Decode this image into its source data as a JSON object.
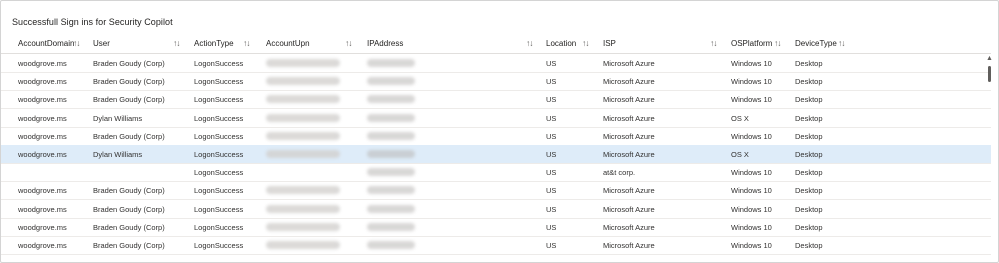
{
  "title": "Successfull Sign ins for Security Copilot",
  "columns": [
    {
      "label": "AccountDomain"
    },
    {
      "label": "User"
    },
    {
      "label": "ActionType"
    },
    {
      "label": "AccountUpn"
    },
    {
      "label": "IPAddress"
    },
    {
      "label": "Location"
    },
    {
      "label": "ISP"
    },
    {
      "label": "OSPlatform"
    },
    {
      "label": "DeviceType"
    }
  ],
  "sort_glyph": "↑↓",
  "rows": [
    {
      "domain": "woodgrove.ms",
      "user": "Braden Goudy (Corp)",
      "action": "LogonSuccess",
      "upn": "",
      "ip": "",
      "location": "US",
      "isp": "Microsoft Azure",
      "os": "Windows 10",
      "device": "Desktop"
    },
    {
      "domain": "woodgrove.ms",
      "user": "Braden Goudy (Corp)",
      "action": "LogonSuccess",
      "upn": "",
      "ip": "",
      "location": "US",
      "isp": "Microsoft Azure",
      "os": "Windows 10",
      "device": "Desktop"
    },
    {
      "domain": "woodgrove.ms",
      "user": "Braden Goudy (Corp)",
      "action": "LogonSuccess",
      "upn": "",
      "ip": "",
      "location": "US",
      "isp": "Microsoft Azure",
      "os": "Windows 10",
      "device": "Desktop"
    },
    {
      "domain": "woodgrove.ms",
      "user": "Dylan Williams",
      "action": "LogonSuccess",
      "upn": "",
      "ip": "",
      "location": "US",
      "isp": "Microsoft Azure",
      "os": "OS X",
      "device": "Desktop"
    },
    {
      "domain": "woodgrove.ms",
      "user": "Braden Goudy (Corp)",
      "action": "LogonSuccess",
      "upn": "",
      "ip": "",
      "location": "US",
      "isp": "Microsoft Azure",
      "os": "Windows 10",
      "device": "Desktop"
    },
    {
      "domain": "woodgrove.ms",
      "user": "Dylan Williams",
      "action": "LogonSuccess",
      "upn": "",
      "ip": "",
      "location": "US",
      "isp": "Microsoft Azure",
      "os": "OS X",
      "device": "Desktop",
      "selected": true
    },
    {
      "domain": "",
      "user": "",
      "action": "LogonSuccess",
      "upn": "",
      "ip": "",
      "location": "US",
      "isp": "at&t corp.",
      "os": "Windows 10",
      "device": "Desktop"
    },
    {
      "domain": "woodgrove.ms",
      "user": "Braden Goudy (Corp)",
      "action": "LogonSuccess",
      "upn": "",
      "ip": "",
      "location": "US",
      "isp": "Microsoft Azure",
      "os": "Windows 10",
      "device": "Desktop"
    },
    {
      "domain": "woodgrove.ms",
      "user": "Braden Goudy (Corp)",
      "action": "LogonSuccess",
      "upn": "",
      "ip": "",
      "location": "US",
      "isp": "Microsoft Azure",
      "os": "Windows 10",
      "device": "Desktop"
    },
    {
      "domain": "woodgrove.ms",
      "user": "Braden Goudy (Corp)",
      "action": "LogonSuccess",
      "upn": "",
      "ip": "",
      "location": "US",
      "isp": "Microsoft Azure",
      "os": "Windows 10",
      "device": "Desktop"
    },
    {
      "domain": "woodgrove.ms",
      "user": "Braden Goudy (Corp)",
      "action": "LogonSuccess",
      "upn": "",
      "ip": "",
      "location": "US",
      "isp": "Microsoft Azure",
      "os": "Windows 10",
      "device": "Desktop"
    }
  ],
  "scrollbar": {
    "up_icon": "scroll-up-arrow-icon",
    "down_icon": "scroll-down-arrow-icon"
  },
  "colors": {
    "selected_row": "#deecf9",
    "border": "#edebe9"
  }
}
